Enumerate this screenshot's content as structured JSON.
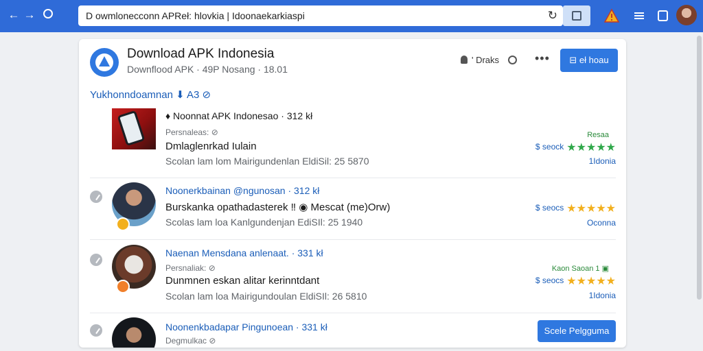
{
  "browser": {
    "back_icon": "←",
    "forward_icon": "→",
    "url": "D owmlonecconn   APReł: hlovkia | Idoonaekarkiaspi",
    "reload_icon": "↻"
  },
  "header": {
    "title": "Download APK Indonesia",
    "subtitle": "Downflood APK · 49P Nosang · 18.01",
    "users_label": "' Draks",
    "follow_label": "⊟ eł hoau"
  },
  "section_title": "Yukhonndoamnan  ⬇ A3 ⊘",
  "rows": [
    {
      "title": "♦ Noonnat APK Indonesao · 312 kł",
      "meta": "Persnaleas: ⊘",
      "desc": "Dmlaglenrkad Iulain",
      "foot": "Scolan lam lom Mairigundenlan EldiSil:     25 5870",
      "tag": "Resaa",
      "price": "$ seock",
      "rating_stars": "★★★★★",
      "region": "1Idonia"
    },
    {
      "title": "Noonerkbainan @ngunosan · 312 kł",
      "desc": "Burskanka opathadasterek ‼ ◉ Mescat (me)Orw)",
      "foot": "Scolas lam loa Kanlgundenjan EdiSIl:      25 1940",
      "price": "$ seocs",
      "rating_stars": "★★★★★",
      "region": "Oconna"
    },
    {
      "title": "Naenan Mensdana anlenaat. · 331 kł",
      "meta": "Persnaliak: ⊘",
      "desc": "Dunmnen eskan alitar kerinntdant",
      "foot": "Scolan lam loa Mairigundoulan EldiSIl:     26 5810",
      "tag": "Kaon   Saoan 1 ▣",
      "price": "$ seocs",
      "rating_stars": "★★★★★",
      "region": "1Idonia"
    },
    {
      "title": "Noonenkbadapar Pingunoean · 331 kł",
      "meta": "Degmulkac ⊘",
      "action_label": "Scele Pelgguma"
    }
  ]
}
